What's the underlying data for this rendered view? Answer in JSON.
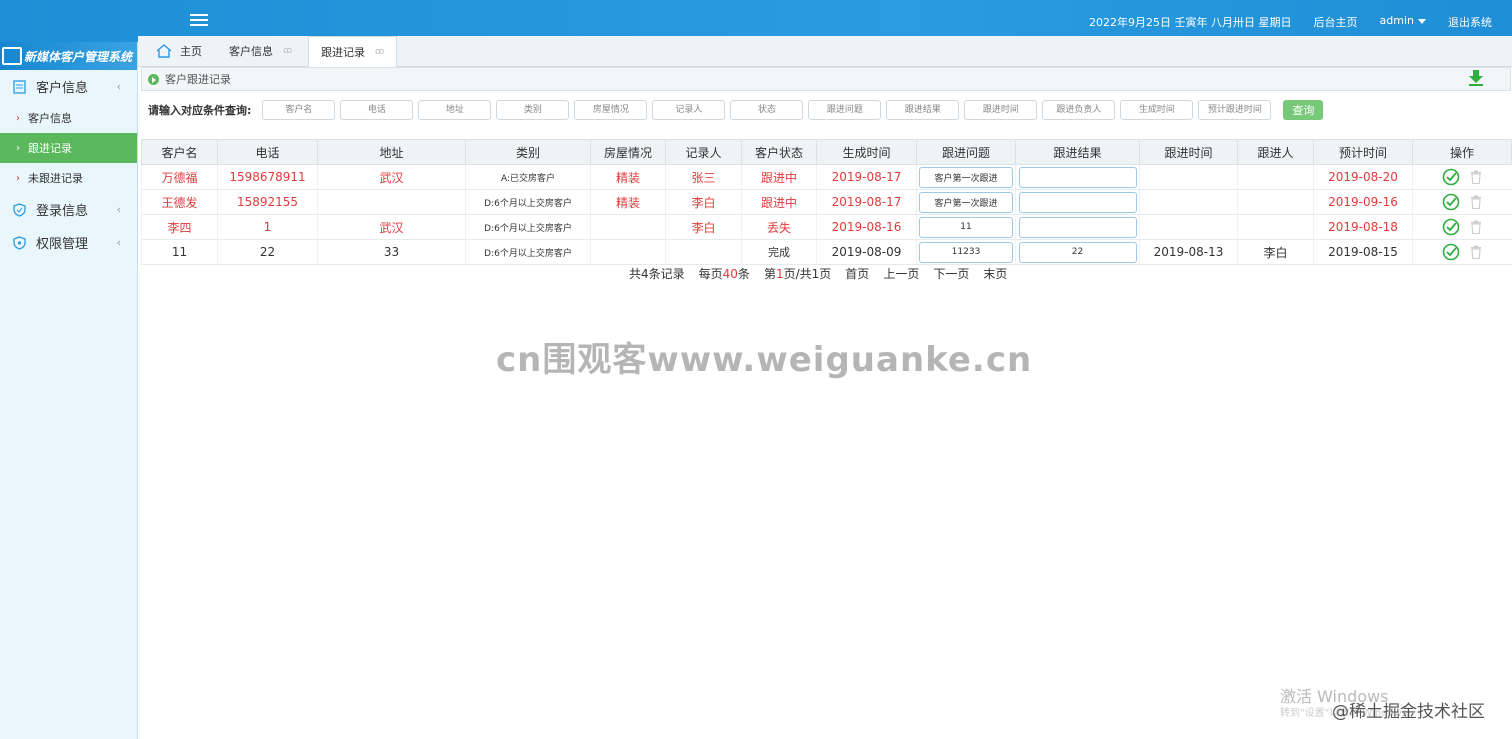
{
  "header": {
    "date_text": "2022年9月25日 壬寅年 八月卅日 星期日",
    "backend_home": "后台主页",
    "user": "admin",
    "logout": "退出系统"
  },
  "sidebar": {
    "logo_text": "新媒体客户管理系统",
    "groups": [
      {
        "label": "客户信息",
        "icon": "document-icon"
      },
      {
        "label": "登录信息",
        "icon": "shield-icon"
      },
      {
        "label": "权限管理",
        "icon": "shield-icon"
      }
    ],
    "sub_items": [
      "客户信息",
      "跟进记录",
      "未跟进记录"
    ]
  },
  "tabs": [
    {
      "label": "主页"
    },
    {
      "label": "客户信息",
      "close": "ꝏ"
    },
    {
      "label": "跟进记录",
      "close": "ꝏ"
    }
  ],
  "breadcrumb": "客户跟进记录",
  "search": {
    "label": "请输入对应条件查询:",
    "placeholders": [
      "客户名",
      "电话",
      "地址",
      "类别",
      "房屋情况",
      "记录人",
      "状态",
      "跟进问题",
      "跟进结果",
      "跟进时间",
      "跟进负责人",
      "生成时间",
      "预计跟进时间"
    ],
    "button": "查询"
  },
  "table": {
    "headers": [
      "客户名",
      "电话",
      "地址",
      "类别",
      "房屋情况",
      "记录人",
      "客户状态",
      "生成时间",
      "跟进问题",
      "跟进结果",
      "跟进时间",
      "跟进人",
      "预计时间",
      "操作"
    ],
    "rows": [
      {
        "name": "万德福",
        "phone": "1598678911",
        "address": "武汉",
        "category": "A:已交房客户",
        "house": "精装",
        "recorder": "张三",
        "status": "跟进中",
        "created": "2019-08-17",
        "issue": "客户第一次跟进",
        "result": "",
        "follow_time": "",
        "follower": "",
        "expected": "2019-08-20",
        "red": true
      },
      {
        "name": "王德发",
        "phone": "15892155",
        "address": "",
        "category": "D:6个月以上交房客户",
        "house": "精装",
        "recorder": "李白",
        "status": "跟进中",
        "created": "2019-08-17",
        "issue": "客户第一次跟进",
        "result": "",
        "follow_time": "",
        "follower": "",
        "expected": "2019-09-16",
        "red": true
      },
      {
        "name": "李四",
        "phone": "1",
        "address": "武汉",
        "category": "D:6个月以上交房客户",
        "house": "",
        "recorder": "李白",
        "status": "丢失",
        "created": "2019-08-16",
        "issue": "11",
        "result": "",
        "follow_time": "",
        "follower": "",
        "expected": "2019-08-18",
        "red": true
      },
      {
        "name": "11",
        "phone": "22",
        "address": "33",
        "category": "D:6个月以上交房客户",
        "house": "",
        "recorder": "",
        "status": "完成",
        "created": "2019-08-09",
        "issue": "11233",
        "result": "22",
        "follow_time": "2019-08-13",
        "follower": "李白",
        "expected": "2019-08-15",
        "red": false
      }
    ]
  },
  "pager": {
    "total": "共4条记录",
    "per_page_prefix": "每页",
    "per_page": "40",
    "per_page_suffix": "条",
    "page_prefix": "第",
    "page": "1",
    "page_suffix": "页/共1页",
    "first": "首页",
    "prev": "上一页",
    "next": "下一页",
    "last": "末页"
  },
  "overlay": {
    "watermark": "cn围观客www.weiguanke.cn",
    "activate_title": "激活 Windows",
    "activate_sub": "转到\"设置\"以激活 Windows。",
    "juejin": "@稀土掘金技术社区"
  },
  "colors": {
    "topbar": "#2a9be0",
    "accent_green": "#5cb85c",
    "alert_red": "#e23b3b"
  }
}
